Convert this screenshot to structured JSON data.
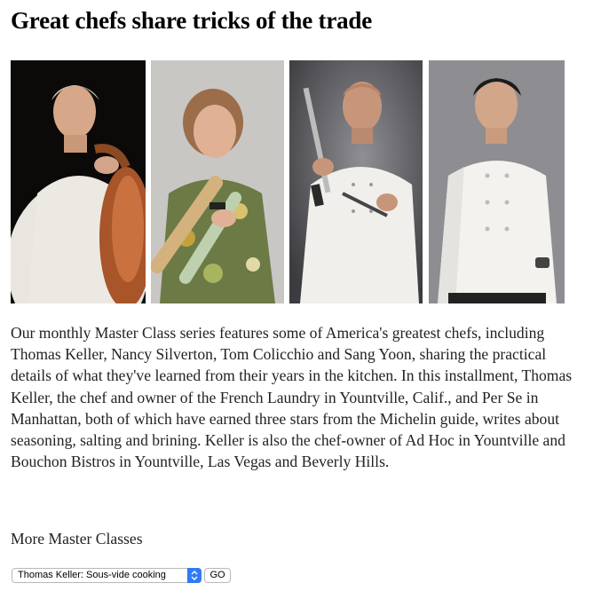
{
  "article": {
    "headline": "Great chefs share tricks of the trade",
    "body": "Our monthly Master Class series features some of America's greatest chefs, including Thomas Keller, Nancy Silverton, Tom Colicchio and Sang Yoon, sharing the practical details of what they've learned from their years in the kitchen. In this installment, Thomas Keller, the chef and owner of the French Laundry in Yountville, Calif., and Per Se in Manhattan, both of which have earned three stars from the Michelin guide, writes about seasoning, salting and brining. Keller is also the chef-owner of Ad Hoc in Yountville and Bouchon Bistros in Yountville, Las Vegas and Beverly Hills.",
    "photos": [
      {
        "subject": "chef with copper pot"
      },
      {
        "subject": "chef with rolling pins"
      },
      {
        "subject": "chef with knife"
      },
      {
        "subject": "chef in white coat"
      }
    ]
  },
  "more": {
    "label": "More Master Classes",
    "select_value": "Thomas Keller: Sous-vide cooking",
    "go_label": "GO"
  },
  "colors": {
    "select_arrow": "#2f7bf5",
    "text": "#222222"
  }
}
